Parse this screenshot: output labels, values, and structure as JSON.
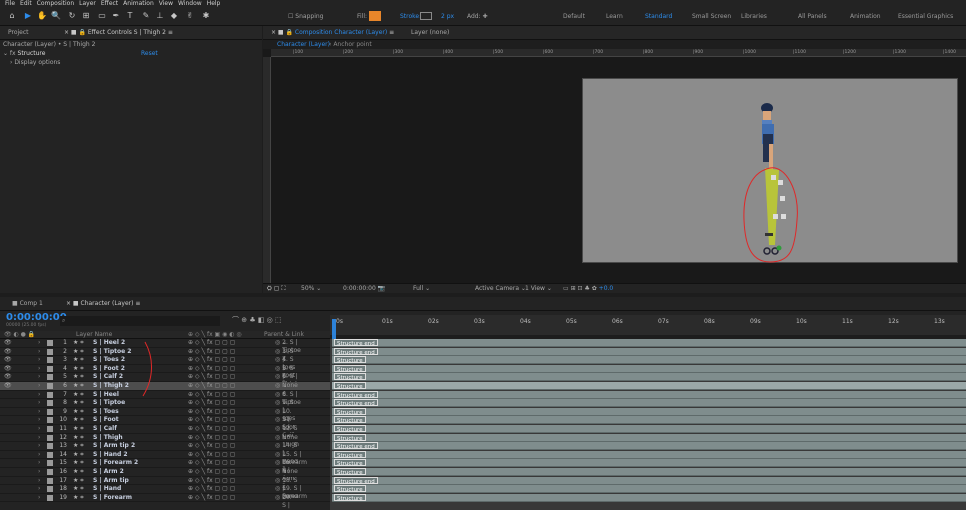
{
  "menu": [
    "File",
    "Edit",
    "Composition",
    "Layer",
    "Effect",
    "Animation",
    "View",
    "Window",
    "Help"
  ],
  "toolbar": {
    "snapping": "Snapping",
    "fill": "Fill:",
    "stroke": "Stroke:",
    "stroke_width": "2 px",
    "add": "Add:",
    "fill_color": "#e8862a",
    "workspaces": [
      "Default",
      "Learn",
      "Standard",
      "Small Screen",
      "Libraries",
      "All Panels",
      "Animation",
      "Essential Graphics"
    ],
    "active_workspace": "Standard"
  },
  "effect_controls": {
    "tab_project": "Project",
    "tab_label": "Effect Controls S | Thigh 2",
    "breadcrumb": "Character (Layer) • S | Thigh 2",
    "effect_name": "Structure",
    "reset": "Reset",
    "display_options": "Display options"
  },
  "composition": {
    "tab_label": "Composition Character (Layer)",
    "layer_tab": "Layer (none)",
    "sub_tab": "Character (Layer)",
    "anchor": "Anchor point",
    "ruler_ticks": [
      "|100",
      "|200",
      "|300",
      "|400",
      "|500",
      "|600",
      "|700",
      "|800",
      "|900",
      "|1000",
      "|1100",
      "|1200",
      "|1300",
      "|1400"
    ],
    "zoom": "50%",
    "timecode": "0:00:00:00",
    "resolution": "Full",
    "camera": "Active Camera",
    "view": "1 View",
    "offset": "+0.0"
  },
  "timeline": {
    "tabs": [
      "Comp 1",
      "Character (Layer)"
    ],
    "timecode": "0:00:00:00",
    "fps": "00000 (25.00 fps)",
    "col_layer": "Layer Name",
    "col_parent": "Parent & Link",
    "time_ticks": [
      "0s",
      "01s",
      "02s",
      "03s",
      "04s",
      "05s",
      "06s",
      "07s",
      "08s",
      "09s",
      "10s",
      "11s",
      "12s",
      "13s"
    ],
    "layers": [
      {
        "num": "1",
        "name": "S | Heel 2",
        "parent": "2. S | Tiptoe 2",
        "bar": "Structure end"
      },
      {
        "num": "2",
        "name": "S | Tiptoe 2",
        "parent": "3. S | Toes 2",
        "bar": "Structure end"
      },
      {
        "num": "3",
        "name": "S | Toes 2",
        "parent": "4. S | Foot 2",
        "bar": "Structure"
      },
      {
        "num": "4",
        "name": "S | Foot 2",
        "parent": "5. S | Calf 2",
        "bar": "Structure"
      },
      {
        "num": "5",
        "name": "S | Calf 2",
        "parent": "6. S | Thigh 2",
        "bar": "Structure"
      },
      {
        "num": "6",
        "name": "S | Thigh 2",
        "parent": "None",
        "bar": "Structure"
      },
      {
        "num": "7",
        "name": "S | Heel",
        "parent": "8. S | Tiptoe",
        "bar": "Structure end"
      },
      {
        "num": "8",
        "name": "S | Tiptoe",
        "parent": "9. S | Toes",
        "bar": "Structure end"
      },
      {
        "num": "9",
        "name": "S | Toes",
        "parent": "10. S | Foot",
        "bar": "Structure"
      },
      {
        "num": "10",
        "name": "S | Foot",
        "parent": "11. S | Calf",
        "bar": "Structure"
      },
      {
        "num": "11",
        "name": "S | Calf",
        "parent": "12. S | Thigh",
        "bar": "Structure"
      },
      {
        "num": "12",
        "name": "S | Thigh",
        "parent": "None",
        "bar": "Structure"
      },
      {
        "num": "13",
        "name": "S | Arm tip 2",
        "parent": "14. S | Hand 2",
        "bar": "Structure end"
      },
      {
        "num": "14",
        "name": "S | Hand 2",
        "parent": "15. S | Forearm",
        "bar": "Structure"
      },
      {
        "num": "15",
        "name": "S | Forearm 2",
        "parent": "16. S | Arm 2",
        "bar": "Structure"
      },
      {
        "num": "16",
        "name": "S | Arm 2",
        "parent": "None",
        "bar": "Structure"
      },
      {
        "num": "17",
        "name": "S | Arm tip",
        "parent": "18. S | Hand",
        "bar": "Structure end"
      },
      {
        "num": "18",
        "name": "S | Hand",
        "parent": "19. S | Forearm",
        "bar": "Structure"
      },
      {
        "num": "19",
        "name": "S | Forearm",
        "parent": "20. S | Arm",
        "bar": "Structure"
      }
    ],
    "selected_layer": "6"
  }
}
